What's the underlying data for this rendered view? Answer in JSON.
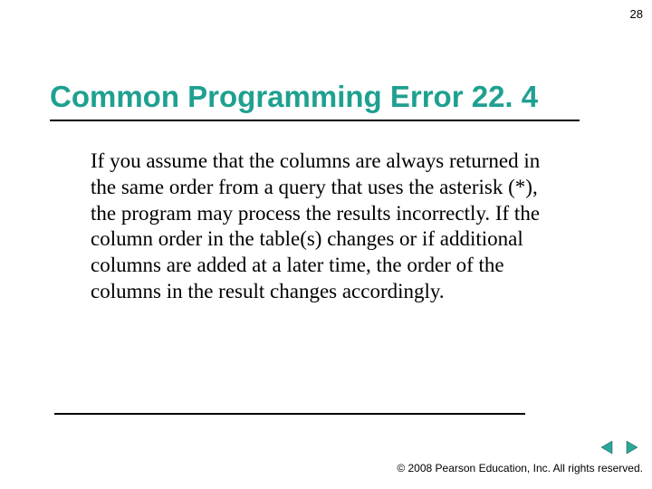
{
  "page_number": "28",
  "title": "Common Programming Error 22. 4",
  "body": "If you assume that the columns are always returned in the same order from a query that uses the asterisk (*), the program may process the results incorrectly. If the column order in the table(s) changes or if additional columns are added at a later time, the order of the columns in the result changes accordingly.",
  "copyright": "© 2008 Pearson Education, Inc.  All rights reserved.",
  "nav": {
    "prev": "previous",
    "next": "next"
  },
  "colors": {
    "title": "#1fa090",
    "nav_arrow": "#2aa79a"
  }
}
